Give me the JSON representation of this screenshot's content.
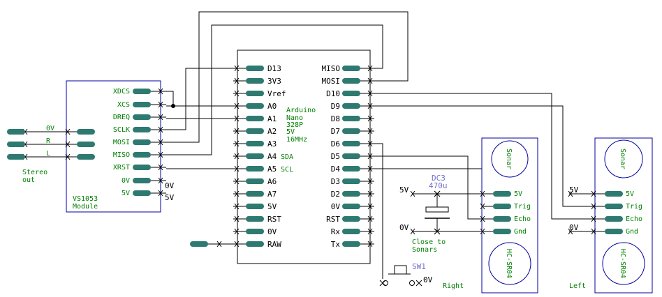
{
  "vs1053": {
    "pins": [
      "XDCS",
      "XCS",
      "DREQ",
      "SCLK",
      "MOSI",
      "MISO",
      "XRST",
      "0V",
      "5V"
    ],
    "title_line1": "VS1053",
    "title_line2": "Module",
    "power_0v": "0V",
    "power_5v": "5V"
  },
  "stereo": {
    "labels": [
      "0V",
      "R",
      "L"
    ],
    "title_line1": "Stereo",
    "title_line2": "out"
  },
  "arduino": {
    "left_pins": [
      "D13",
      "3V3",
      "Vref",
      "A0",
      "A1",
      "A2",
      "A3",
      "A4",
      "A5",
      "A6",
      "A7",
      "5V",
      "RST",
      "0V",
      "RAW"
    ],
    "right_pins": [
      "MISO",
      "MOSI",
      "D10",
      "D9",
      "D8",
      "D7",
      "D6",
      "D5",
      "D4",
      "D3",
      "D2",
      "0V",
      "RST",
      "Rx",
      "Tx"
    ],
    "a4_suffix": "SDA",
    "a5_suffix": "SCL",
    "info": [
      "Arduino",
      "Nano",
      "328P",
      "5V",
      "16MHz"
    ]
  },
  "capacitor": {
    "name": "DC3",
    "value": "470u",
    "note_line1": "Close to",
    "note_line2": "Sonars",
    "rail_5v": "5V",
    "rail_0v": "0V"
  },
  "switch": {
    "name": "SW1",
    "ground": "0V"
  },
  "sonar_right": {
    "top_label": "Sonar",
    "bottom_label": "HC-SR04",
    "pins": [
      "5V",
      "Trig",
      "Echo",
      "Gnd"
    ],
    "caption": "Right"
  },
  "sonar_left": {
    "top_label": "Sonar",
    "bottom_label": "HC-SR04",
    "pins": [
      "5V",
      "Trig",
      "Echo",
      "Gnd"
    ],
    "caption": "Left",
    "rail_5v": "5V",
    "rail_0v": "0V"
  }
}
